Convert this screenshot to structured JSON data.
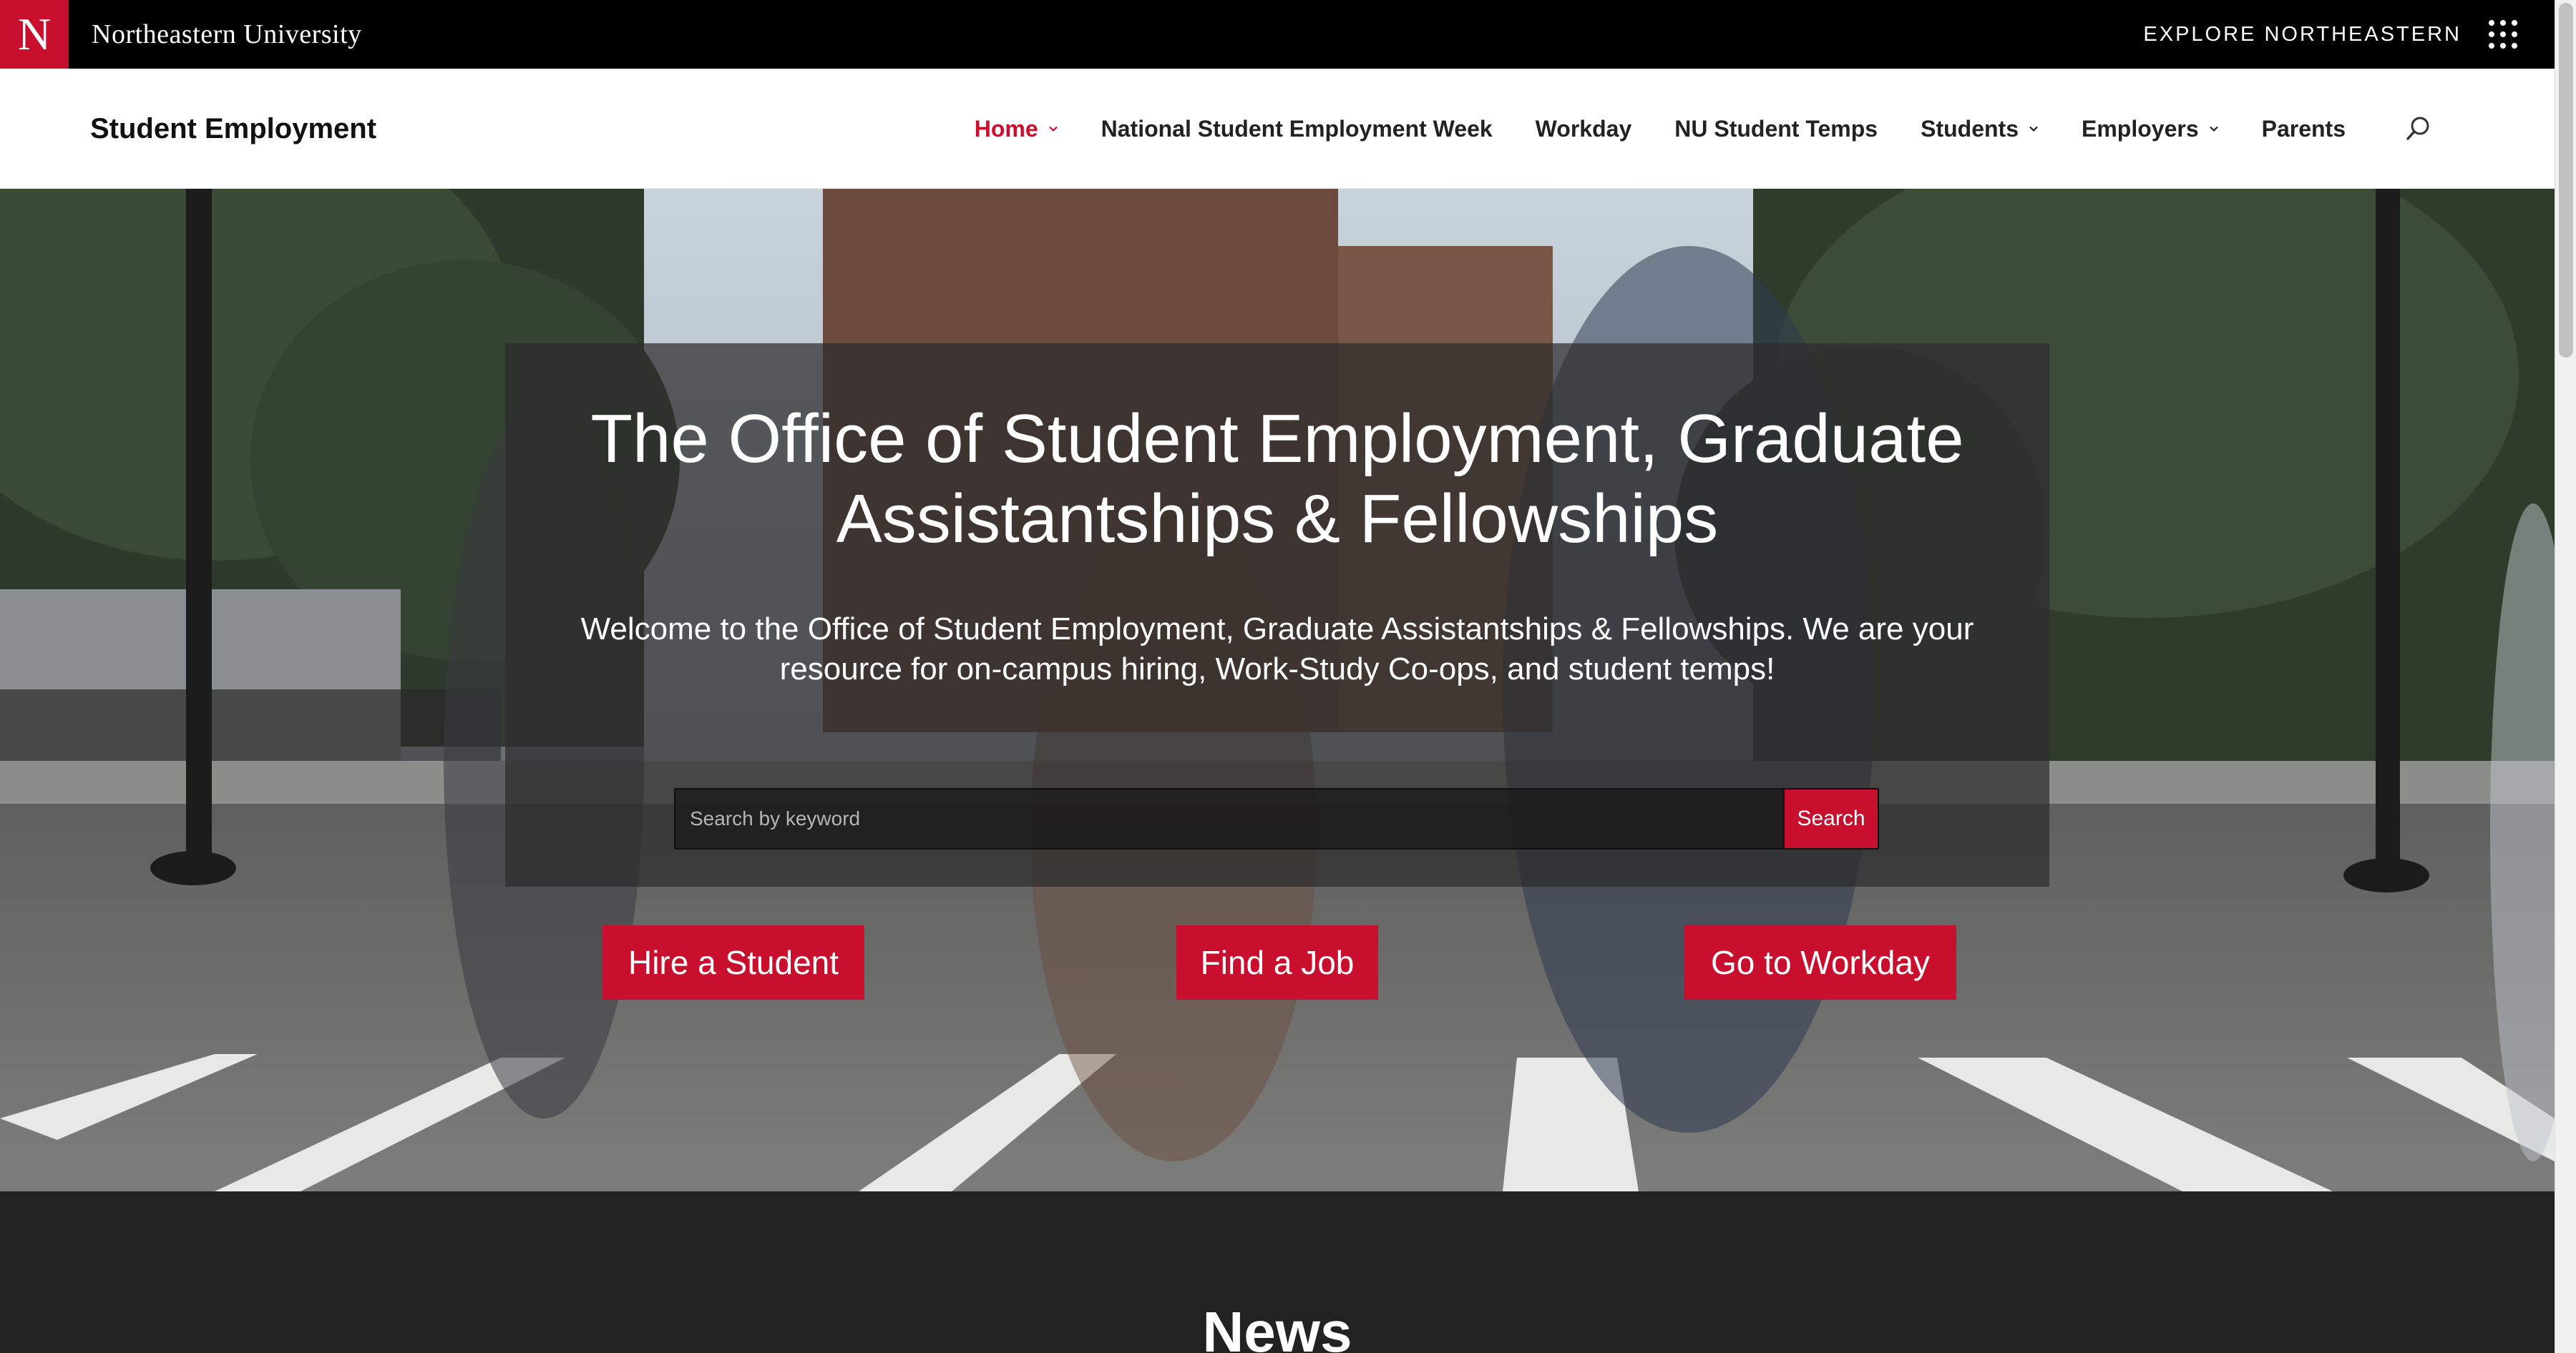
{
  "global_bar": {
    "logo_letter": "N",
    "wordmark": "Northeastern University",
    "explore_label": "EXPLORE NORTHEASTERN",
    "apps_icon": "grid-dots-icon"
  },
  "site": {
    "title": "Student Employment"
  },
  "nav": {
    "items": [
      {
        "label": "Home",
        "active": true,
        "has_dropdown": true
      },
      {
        "label": "National Student Employment Week",
        "active": false,
        "has_dropdown": false
      },
      {
        "label": "Workday",
        "active": false,
        "has_dropdown": false
      },
      {
        "label": "NU Student Temps",
        "active": false,
        "has_dropdown": false
      },
      {
        "label": "Students",
        "active": false,
        "has_dropdown": true
      },
      {
        "label": "Employers",
        "active": false,
        "has_dropdown": true
      },
      {
        "label": "Parents",
        "active": false,
        "has_dropdown": false
      }
    ],
    "search_icon": "search-icon"
  },
  "hero": {
    "title": "The Office of Student Employment, Graduate Assistantships & Fellowships",
    "subtitle": "Welcome to the Office of Student Employment, Graduate Assistantships & Fellowships. We are your resource for on-campus hiring, Work-Study Co-ops, and student temps!",
    "search": {
      "placeholder": "Search by keyword",
      "value": "",
      "button_label": "Search"
    },
    "cta": {
      "hire": "Hire a Student",
      "find_job": "Find a Job",
      "workday": "Go to Workday"
    }
  },
  "news": {
    "heading": "News"
  },
  "colors": {
    "brand_red": "#c8102e",
    "global_bar_bg": "#000000",
    "nav_bg": "#ffffff",
    "overlay_bg": "rgba(45,45,45,0.72)",
    "news_bg": "#222222"
  }
}
